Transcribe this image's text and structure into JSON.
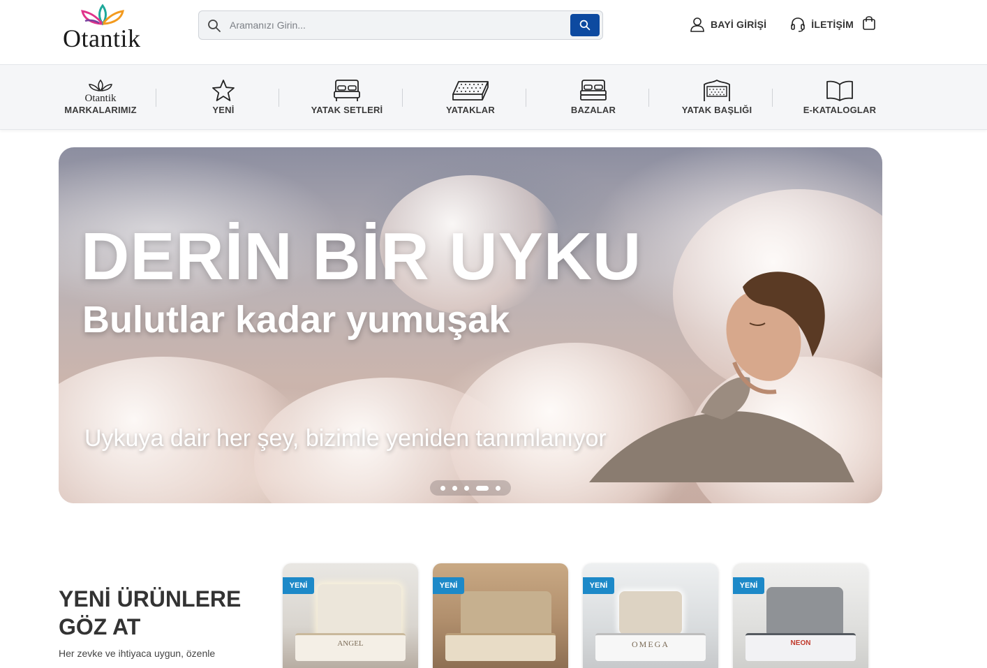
{
  "brand": {
    "name": "Otantik"
  },
  "search": {
    "placeholder": "Aramanızı Girin..."
  },
  "toplinks": {
    "dealer_login": "BAYİ GİRİŞİ",
    "contact": "İLETİŞİM"
  },
  "icons": {
    "search": "search-icon",
    "user": "user-icon",
    "headset": "headset-icon",
    "cart": "shopping-bag-icon"
  },
  "nav": {
    "items": [
      {
        "label": "MARKALARIMIZ",
        "icon": "otantik-logo-icon"
      },
      {
        "label": "YENİ",
        "icon": "star-icon"
      },
      {
        "label": "YATAK SETLERİ",
        "icon": "bed-set-icon"
      },
      {
        "label": "YATAKLAR",
        "icon": "mattress-icon"
      },
      {
        "label": "BAZALAR",
        "icon": "bed-base-icon"
      },
      {
        "label": "YATAK BAŞLIĞI",
        "icon": "headboard-icon"
      },
      {
        "label": "E-KATALOGLAR",
        "icon": "book-icon"
      }
    ]
  },
  "hero": {
    "headline": "DERİN BİR UYKU",
    "subheadline": "Bulutlar kadar yumuşak",
    "tagline": "Uykuya dair her şey, bizimle yeniden tanımlanıyor",
    "slide_count": 5,
    "active_slide": 4
  },
  "new_products": {
    "title_line1": "YENİ ÜRÜNLERE",
    "title_line2": "GÖZ AT",
    "description": "Her zevke ve ihtiyaca uygun, özenle",
    "cards": [
      {
        "badge": "YENİ",
        "name": "ANGEL"
      },
      {
        "badge": "YENİ",
        "name": ""
      },
      {
        "badge": "YENİ",
        "name": "OMEGA"
      },
      {
        "badge": "YENİ",
        "name": "NEON"
      }
    ]
  },
  "colors": {
    "accent": "#0d4aa0",
    "badge": "#1d89c8",
    "logo_pink": "#e0338a",
    "logo_teal": "#1ea89a",
    "logo_orange": "#f39a1e",
    "logo_purple": "#7a3e9d"
  }
}
